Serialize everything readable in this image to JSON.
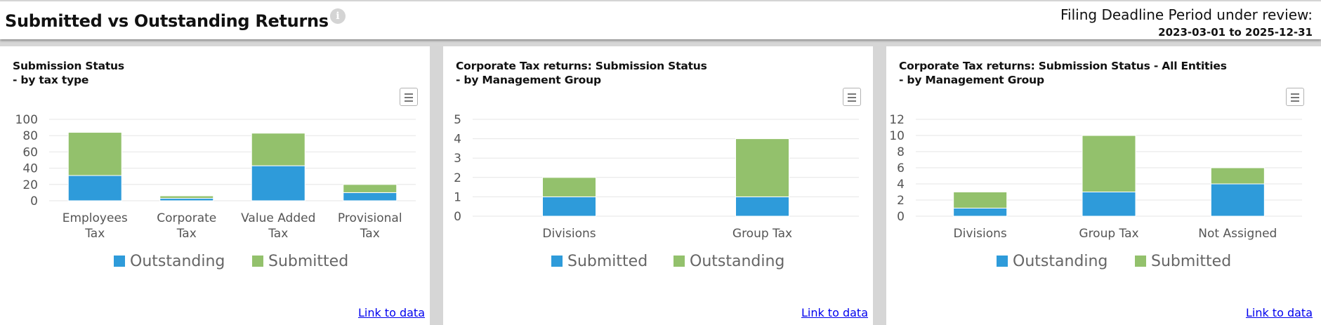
{
  "header": {
    "title": "Submitted vs Outstanding Returns",
    "info_icon": "info-icon",
    "period_label": "Filing Deadline Period under review:",
    "period_range": "2023-03-01 to 2025-12-31"
  },
  "colors": {
    "blue": "#2E9BDA",
    "green": "#93C16C"
  },
  "panels": [
    {
      "link_label": "Link to data",
      "menu_icon": "hamburger-menu-icon"
    },
    {
      "link_label": "Link to data",
      "menu_icon": "hamburger-menu-icon"
    },
    {
      "link_label": "Link to data",
      "menu_icon": "hamburger-menu-icon"
    }
  ],
  "chart_data": [
    {
      "type": "bar",
      "stacked": true,
      "title": "Submission Status\n- by tax type",
      "categories": [
        "Employees\nTax",
        "Corporate\nTax",
        "Value Added\nTax",
        "Provisional\nTax"
      ],
      "series": [
        {
          "name": "Outstanding",
          "values": [
            31,
            3,
            43,
            10
          ],
          "color": "#2E9BDA"
        },
        {
          "name": "Submitted",
          "values": [
            53,
            3,
            40,
            10
          ],
          "color": "#93C16C"
        }
      ],
      "ylim": [
        0,
        100
      ],
      "yticks": [
        0,
        20,
        40,
        60,
        80,
        100
      ],
      "legend": [
        {
          "name": "Outstanding",
          "color": "#2E9BDA"
        },
        {
          "name": "Submitted",
          "color": "#93C16C"
        }
      ],
      "legend_position": "bottom-center",
      "grid": true
    },
    {
      "type": "bar",
      "stacked": true,
      "title": "Corporate Tax returns: Submission Status\n- by Management Group",
      "categories": [
        "Divisions",
        "Group Tax"
      ],
      "series": [
        {
          "name": "Submitted",
          "values": [
            1,
            1
          ],
          "color": "#2E9BDA"
        },
        {
          "name": "Outstanding",
          "values": [
            1,
            3
          ],
          "color": "#93C16C"
        }
      ],
      "ylim": [
        0,
        5
      ],
      "yticks": [
        0,
        1,
        2,
        3,
        4,
        5
      ],
      "legend": [
        {
          "name": "Submitted",
          "color": "#2E9BDA"
        },
        {
          "name": "Outstanding",
          "color": "#93C16C"
        }
      ],
      "legend_position": "bottom-center",
      "grid": true
    },
    {
      "type": "bar",
      "stacked": true,
      "title": "Corporate Tax returns: Submission Status - All Entities\n- by Management Group",
      "categories": [
        "Divisions",
        "Group Tax",
        "Not Assigned"
      ],
      "series": [
        {
          "name": "Outstanding",
          "values": [
            1,
            3,
            4
          ],
          "color": "#2E9BDA"
        },
        {
          "name": "Submitted",
          "values": [
            2,
            7,
            2
          ],
          "color": "#93C16C"
        }
      ],
      "ylim": [
        0,
        12
      ],
      "yticks": [
        0,
        2,
        4,
        6,
        8,
        10,
        12
      ],
      "legend": [
        {
          "name": "Outstanding",
          "color": "#2E9BDA"
        },
        {
          "name": "Submitted",
          "color": "#93C16C"
        }
      ],
      "legend_position": "bottom-center",
      "grid": true
    }
  ]
}
